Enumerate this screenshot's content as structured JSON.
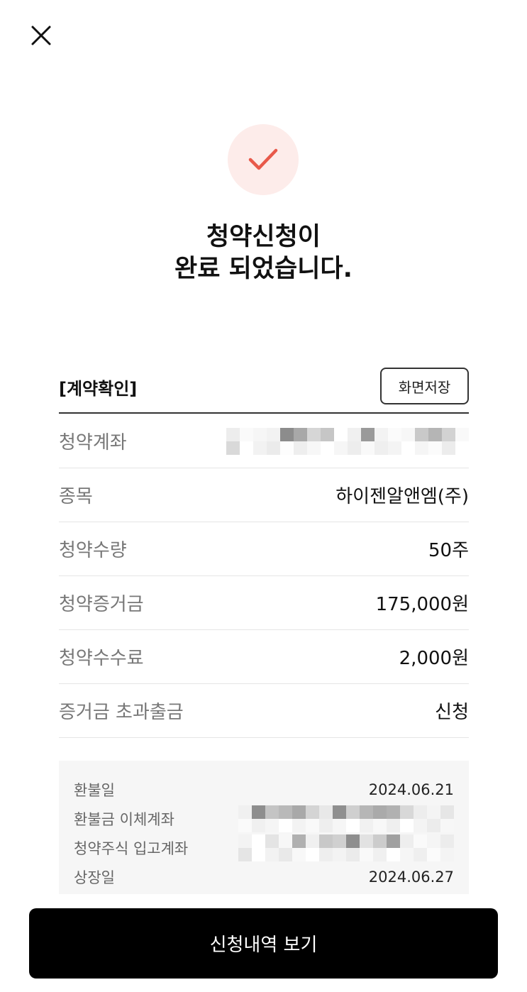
{
  "header": {
    "close_icon": "close-icon"
  },
  "status": {
    "icon": "checkmark-icon",
    "accent_color": "#e8594a",
    "circle_color": "#fdecea",
    "title_line1": "청약신청이",
    "title_line2": "완료 되었습니다."
  },
  "contract": {
    "section_title": "[계약확인]",
    "save_button": "화면저장",
    "rows": [
      {
        "label": "청약계좌",
        "value": ""
      },
      {
        "label": "종목",
        "value": "하이젠알앤엠(주)"
      },
      {
        "label": "청약수량",
        "value": "50주"
      },
      {
        "label": "청약증거금",
        "value": "175,000원"
      },
      {
        "label": "청약수수료",
        "value": "2,000원"
      },
      {
        "label": "증거금 초과출금",
        "value": "신청"
      }
    ]
  },
  "refund": {
    "rows": [
      {
        "label": "환불일",
        "value": "2024.06.21"
      },
      {
        "label": "환불금 이체계좌",
        "value": ""
      },
      {
        "label": "청약주식 입고계좌",
        "value": ""
      },
      {
        "label": "상장일",
        "value": "2024.06.27"
      }
    ]
  },
  "footer": {
    "view_history_button": "신청내역 보기"
  }
}
